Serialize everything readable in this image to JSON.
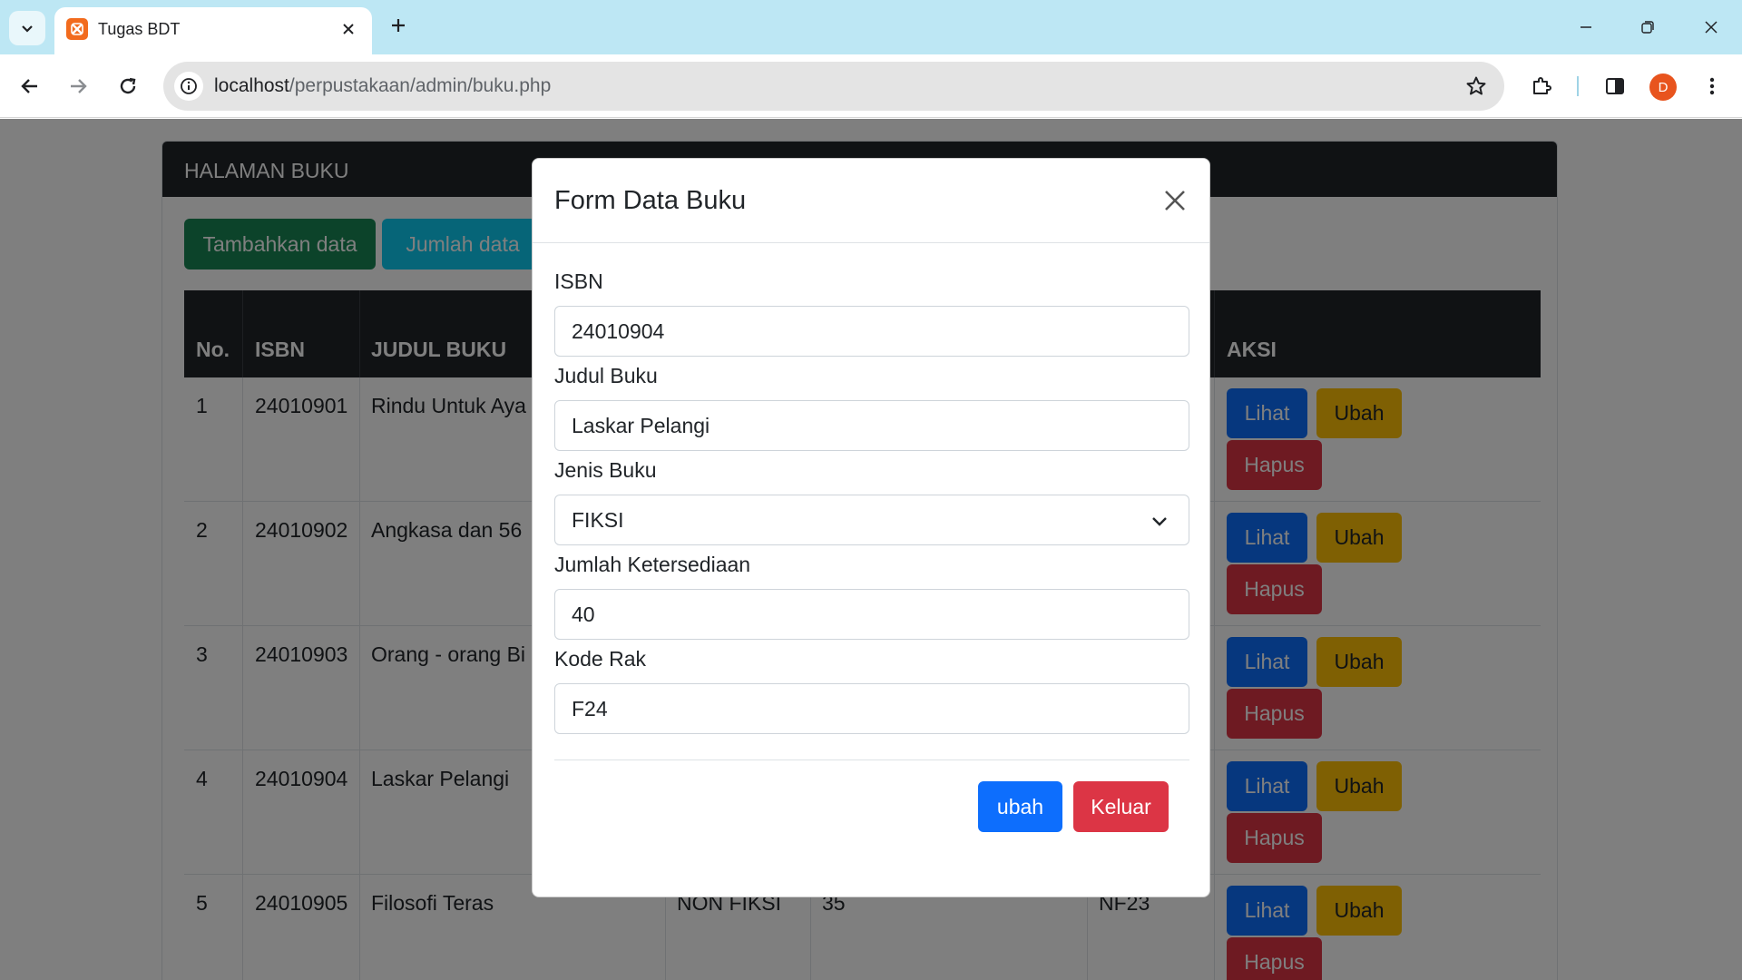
{
  "browser": {
    "tab_title": "Tugas BDT",
    "url_host": "localhost",
    "url_path": "/perpustakaan/admin/buku.php",
    "profile_initial": "D",
    "accent_color": "#bde7f4"
  },
  "page": {
    "card_title": "HALAMAN BUKU",
    "btn_add": "Tambahkan data",
    "btn_count": "Jumlah data",
    "table": {
      "headers": [
        "No.",
        "ISBN",
        "JUDUL BUKU",
        "AKSI"
      ],
      "rows": [
        {
          "no": "1",
          "isbn": "24010901",
          "title": "Rindu Untuk Aya",
          "jenis": "",
          "jumlah": "",
          "rak": ""
        },
        {
          "no": "2",
          "isbn": "24010902",
          "title": "Angkasa dan 56",
          "jenis": "",
          "jumlah": "",
          "rak": ""
        },
        {
          "no": "3",
          "isbn": "24010903",
          "title": "Orang - orang Bi",
          "jenis": "",
          "jumlah": "",
          "rak": ""
        },
        {
          "no": "4",
          "isbn": "24010904",
          "title": "Laskar Pelangi",
          "jenis": "",
          "jumlah": "",
          "rak": ""
        },
        {
          "no": "5",
          "isbn": "24010905",
          "title": "Filosofi Teras",
          "jenis": "NON FIKSI",
          "jumlah": "35",
          "rak": "NF23"
        }
      ],
      "actions": {
        "view": "Lihat",
        "edit": "Ubah",
        "delete": "Hapus"
      }
    }
  },
  "modal": {
    "title": "Form Data Buku",
    "fields": {
      "isbn": {
        "label": "ISBN",
        "value": "24010904"
      },
      "judul": {
        "label": "Judul Buku",
        "value": "Laskar Pelangi"
      },
      "jenis": {
        "label": "Jenis Buku",
        "value": "FIKSI"
      },
      "jumlah": {
        "label": "Jumlah Ketersediaan",
        "value": "40"
      },
      "rak": {
        "label": "Kode Rak",
        "value": "F24"
      }
    },
    "btn_submit": "ubah",
    "btn_exit": "Keluar"
  }
}
